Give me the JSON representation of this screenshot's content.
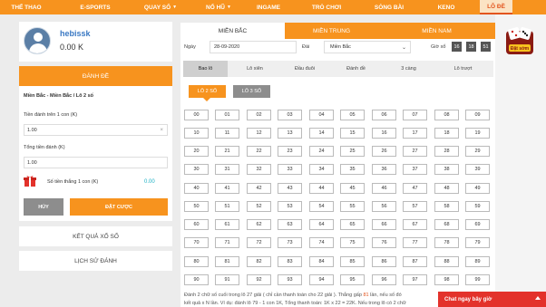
{
  "nav": {
    "items": [
      {
        "label": "THỂ THAO",
        "has_caret": false
      },
      {
        "label": "E-SPORTS",
        "has_caret": false
      },
      {
        "label": "QUAY SỐ",
        "has_caret": true
      },
      {
        "label": "NỔ HŨ",
        "has_caret": true
      },
      {
        "label": "INGAME",
        "has_caret": false
      },
      {
        "label": "TRÒ CHƠI",
        "has_caret": false
      },
      {
        "label": "SÒNG BÀI",
        "has_caret": false
      },
      {
        "label": "KENO",
        "has_caret": false
      },
      {
        "label": "LÔ ĐỀ",
        "has_caret": false
      }
    ],
    "active_index": 8
  },
  "user": {
    "name": "hebissk",
    "balance": "0.00 K"
  },
  "bet_panel": {
    "header": "ĐÁNH ĐỀ",
    "subtitle": "Miền Bắc - Miền Bắc / Lô 2 số",
    "per_number_label": "Tiền đánh trên 1 con (K)",
    "per_number_value": "1.00",
    "total_label": "Tổng tiền đánh (K)",
    "total_value": "1.00",
    "win_label": "Số tiền thắng 1 con (K)",
    "win_value": "0.00",
    "cancel_label": "HỦY",
    "submit_label": "ĐẶT CƯỢC",
    "clear_icon": "×"
  },
  "links": {
    "results": "KẾT QUẢ XỔ SỐ",
    "history": "LỊCH SỬ ĐÁNH"
  },
  "region_tabs": [
    "MIỀN BẮC",
    "MIỀN TRUNG",
    "MIỀN NAM"
  ],
  "filters": {
    "date_label": "Ngày",
    "date_value": "28-09-2020",
    "station_label": "Đài",
    "station_value": "Miền Bắc",
    "time_label": "Giờ xổ",
    "time": [
      "16",
      "18",
      "51"
    ]
  },
  "game_tabs": [
    "Bao lô",
    "Lô xiên",
    "Đầu đuôi",
    "Đánh đề",
    "3 càng",
    "Lô trượt"
  ],
  "sub_tabs": [
    "LÔ 2 SỐ",
    "LÔ 3 SỐ"
  ],
  "numbers": [
    "00",
    "01",
    "02",
    "03",
    "04",
    "05",
    "06",
    "07",
    "08",
    "09",
    "10",
    "11",
    "12",
    "13",
    "14",
    "15",
    "16",
    "17",
    "18",
    "19",
    "20",
    "21",
    "22",
    "23",
    "24",
    "25",
    "26",
    "27",
    "28",
    "29",
    "30",
    "31",
    "32",
    "33",
    "34",
    "35",
    "36",
    "37",
    "38",
    "39",
    "40",
    "41",
    "42",
    "43",
    "44",
    "45",
    "46",
    "47",
    "48",
    "49",
    "50",
    "51",
    "52",
    "53",
    "54",
    "55",
    "56",
    "57",
    "58",
    "59",
    "60",
    "61",
    "62",
    "63",
    "64",
    "65",
    "66",
    "67",
    "68",
    "69",
    "70",
    "71",
    "72",
    "73",
    "74",
    "75",
    "76",
    "77",
    "78",
    "79",
    "80",
    "81",
    "82",
    "83",
    "84",
    "85",
    "86",
    "87",
    "88",
    "89",
    "90",
    "91",
    "92",
    "93",
    "94",
    "95",
    "96",
    "97",
    "98",
    "99"
  ],
  "footnote": {
    "line1_a": "Đánh 2 chữ số cuối trong lô 27 giải ( chỉ cần thanh toán cho 22 giải ). Thắng gấp ",
    "line1_b": "81",
    "line1_c": " lần, nếu số đó",
    "line2": "kết quả x N lần. Ví dụ: đánh lô 79 - 1 con 1K, Tổng thanh toán: 1K x 22 = 22K. Nếu trong lô có 2 chữ"
  },
  "promo_badge": "Đặt sớm",
  "chat": {
    "label": "Chat ngay bây giờ"
  },
  "colors": {
    "brand": "#f7931e",
    "accent_red": "#e3541d",
    "chat": "#e3322b",
    "balance_blue": "#3a78c3"
  }
}
